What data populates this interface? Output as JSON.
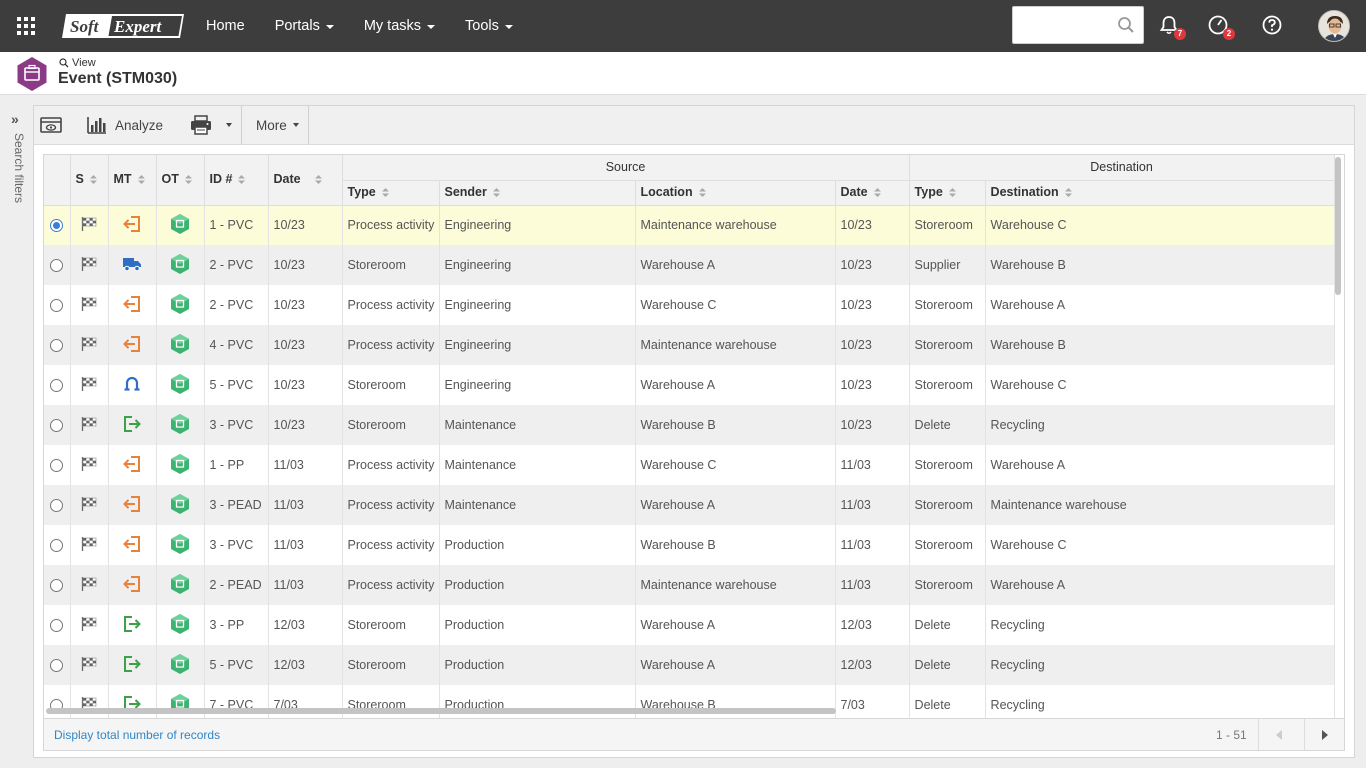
{
  "topbar": {
    "brand": "SoftExpert",
    "nav": [
      "Home",
      "Portals",
      "My tasks",
      "Tools"
    ],
    "nav_has_caret": [
      false,
      true,
      true,
      true
    ],
    "search_placeholder": "",
    "notifications_count": "7",
    "tasks_count": "2"
  },
  "title": {
    "view_label": "View",
    "page_title": "Event (STM030)",
    "accent": "#8b3a86"
  },
  "side": {
    "label": "Search filters"
  },
  "toolbar": {
    "analyze": "Analyze",
    "more": "More"
  },
  "grid": {
    "group_source": "Source",
    "group_destination": "Destination",
    "columns": {
      "s": "S",
      "mt": "MT",
      "ot": "OT",
      "id": "ID #",
      "date": "Date",
      "src_type": "Type",
      "sender": "Sender",
      "location": "Location",
      "src_date": "Date",
      "dst_type": "Type",
      "destination": "Destination"
    },
    "rows": [
      {
        "mt": "in",
        "id": "1 - PVC",
        "date": "10/23",
        "src_type": "Process activity",
        "sender": "Engineering",
        "location": "Maintenance warehouse",
        "src_date": "10/23",
        "dst_type": "Storeroom",
        "destination": "Warehouse C"
      },
      {
        "mt": "truck",
        "id": "2 - PVC",
        "date": "10/23",
        "src_type": "Storeroom",
        "sender": "Engineering",
        "location": "Warehouse A",
        "src_date": "10/23",
        "dst_type": "Supplier",
        "destination": "Warehouse B"
      },
      {
        "mt": "in",
        "id": "2 - PVC",
        "date": "10/23",
        "src_type": "Process activity",
        "sender": "Engineering",
        "location": "Warehouse C",
        "src_date": "10/23",
        "dst_type": "Storeroom",
        "destination": "Warehouse A"
      },
      {
        "mt": "in",
        "id": "4 - PVC",
        "date": "10/23",
        "src_type": "Process activity",
        "sender": "Engineering",
        "location": "Maintenance warehouse",
        "src_date": "10/23",
        "dst_type": "Storeroom",
        "destination": "Warehouse B"
      },
      {
        "mt": "return",
        "id": "5 - PVC",
        "date": "10/23",
        "src_type": "Storeroom",
        "sender": "Engineering",
        "location": "Warehouse A",
        "src_date": "10/23",
        "dst_type": "Storeroom",
        "destination": "Warehouse C"
      },
      {
        "mt": "out",
        "id": "3 - PVC",
        "date": "10/23",
        "src_type": "Storeroom",
        "sender": "Maintenance",
        "location": "Warehouse B",
        "src_date": "10/23",
        "dst_type": "Delete",
        "destination": "Recycling"
      },
      {
        "mt": "in",
        "id": "1 - PP",
        "date": "11/03",
        "src_type": "Process activity",
        "sender": "Maintenance",
        "location": "Warehouse C",
        "src_date": "11/03",
        "dst_type": "Storeroom",
        "destination": "Warehouse A"
      },
      {
        "mt": "in",
        "id": "3 - PEAD",
        "date": "11/03",
        "src_type": "Process activity",
        "sender": "Maintenance",
        "location": "Warehouse A",
        "src_date": "11/03",
        "dst_type": "Storeroom",
        "destination": "Maintenance warehouse"
      },
      {
        "mt": "in",
        "id": "3 - PVC",
        "date": "11/03",
        "src_type": "Process activity",
        "sender": "Production",
        "location": "Warehouse B",
        "src_date": "11/03",
        "dst_type": "Storeroom",
        "destination": "Warehouse C"
      },
      {
        "mt": "in",
        "id": "2 - PEAD",
        "date": "11/03",
        "src_type": "Process activity",
        "sender": "Production",
        "location": "Maintenance warehouse",
        "src_date": "11/03",
        "dst_type": "Storeroom",
        "destination": "Warehouse A"
      },
      {
        "mt": "out",
        "id": "3 - PP",
        "date": "12/03",
        "src_type": "Storeroom",
        "sender": "Production",
        "location": "Warehouse A",
        "src_date": "12/03",
        "dst_type": "Delete",
        "destination": "Recycling"
      },
      {
        "mt": "out",
        "id": "5 - PVC",
        "date": "12/03",
        "src_type": "Storeroom",
        "sender": "Production",
        "location": "Warehouse A",
        "src_date": "12/03",
        "dst_type": "Delete",
        "destination": "Recycling"
      },
      {
        "mt": "out",
        "id": "7 - PVC",
        "date": "7/03",
        "src_type": "Storeroom",
        "sender": "Production",
        "location": "Warehouse B",
        "src_date": "7/03",
        "dst_type": "Delete",
        "destination": "Recycling"
      }
    ],
    "selected_row": 0
  },
  "footer": {
    "display_total": "Display total number of records",
    "range": "1 - 51"
  },
  "colors": {
    "topbar": "#3d3d3d",
    "selected_row": "#fcfcd8",
    "link": "#2f86c8",
    "in_icon": "#e8823a",
    "out_icon": "#3fa04a",
    "truck_icon": "#2e6fc4",
    "ot_icon": "#3cb371"
  }
}
